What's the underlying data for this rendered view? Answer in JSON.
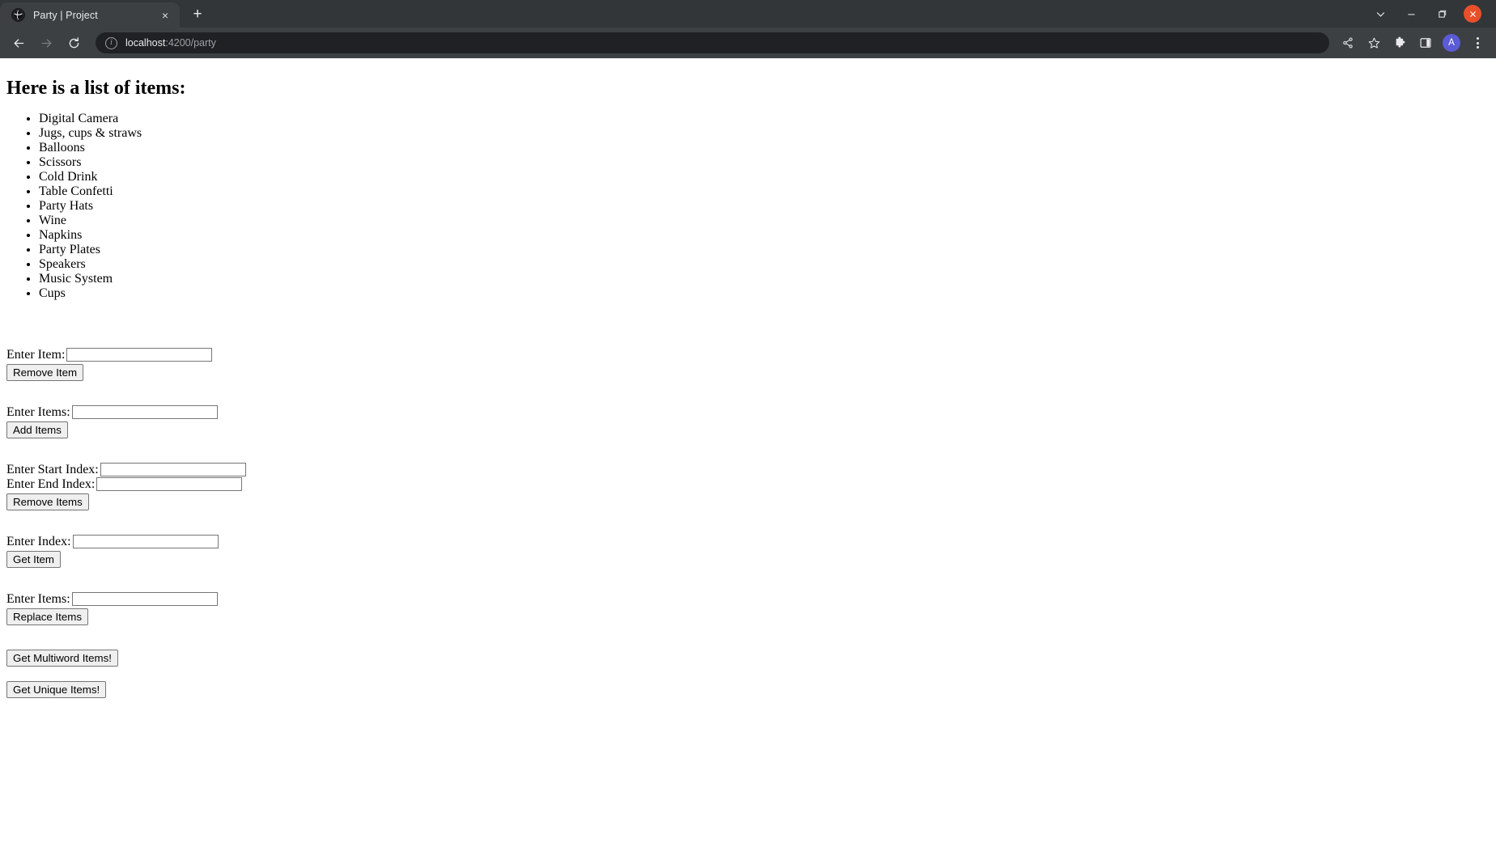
{
  "browser": {
    "tab": {
      "title": "Party | Project",
      "favicon_name": "angular-globe-favicon",
      "close_label": "×"
    },
    "new_tab_label": "+",
    "window_controls": {
      "tab_search_name": "tab-search-chevron-icon",
      "minimize_label": "–",
      "maximize_name": "maximize-icon",
      "close_label": "×",
      "close_color": "#e8502a"
    },
    "nav": {
      "back_name": "back-arrow-icon",
      "forward_name": "forward-arrow-icon",
      "reload_name": "reload-icon"
    },
    "omnibox": {
      "info_icon_label": "i",
      "host": "localhost",
      "path": ":4200/party",
      "full_url": "localhost:4200/party"
    },
    "toolbar_icons": [
      {
        "name": "share-icon",
        "label": "share"
      },
      {
        "name": "bookmark-star-icon",
        "label": "bookmark"
      },
      {
        "name": "extensions-puzzle-icon",
        "label": "extensions"
      },
      {
        "name": "side-panel-icon",
        "label": "side panel"
      }
    ],
    "profile": {
      "initial": "A",
      "color": "#5b5bd6"
    },
    "menu_name": "three-dot-menu-icon"
  },
  "page": {
    "heading": "Here is a list of items:",
    "items": [
      "Digital Camera",
      "Jugs, cups & straws",
      "Balloons",
      "Scissors",
      "Cold Drink",
      "Table Confetti",
      "Party Hats",
      "Wine",
      "Napkins",
      "Party Plates",
      "Speakers",
      "Music System",
      "Cups"
    ],
    "forms": {
      "remove_item": {
        "label": "Enter Item:",
        "value": "",
        "placeholder": "",
        "button": "Remove Item"
      },
      "add_items": {
        "label": "Enter Items:",
        "value": "",
        "placeholder": "",
        "button": "Add Items"
      },
      "remove_range": {
        "start_label": "Enter Start Index:",
        "start_value": "",
        "end_label": "Enter End Index:",
        "end_value": "",
        "button": "Remove Items"
      },
      "get_item": {
        "label": "Enter Index:",
        "value": "",
        "placeholder": "",
        "button": "Get Item"
      },
      "replace_items": {
        "label": "Enter Items:",
        "value": "",
        "placeholder": "",
        "button": "Replace Items"
      },
      "multiword_button": "Get Multiword Items!",
      "unique_button": "Get Unique Items!"
    }
  }
}
